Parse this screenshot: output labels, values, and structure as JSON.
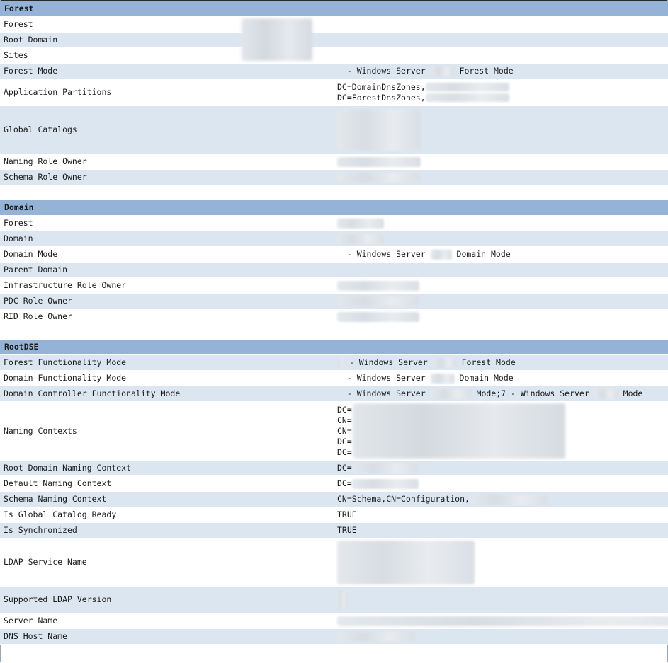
{
  "sections": {
    "forest": {
      "title": "Forest",
      "rows": [
        {
          "label": "Forest",
          "value": ""
        },
        {
          "label": "Root Domain",
          "value": ""
        },
        {
          "label": "Sites",
          "value": ""
        },
        {
          "label": "Forest Mode",
          "value_pre": "- Windows Server",
          "value_post": "Forest Mode"
        },
        {
          "label": "Application Partitions",
          "lines": [
            "DC=DomainDnsZones,",
            "DC=ForestDnsZones,"
          ]
        },
        {
          "label": "Global Catalogs",
          "value": ""
        },
        {
          "label": "Naming Role Owner",
          "value": ""
        },
        {
          "label": "Schema Role Owner",
          "value": ""
        }
      ]
    },
    "domain": {
      "title": "Domain",
      "rows": [
        {
          "label": "Forest",
          "value": ""
        },
        {
          "label": "Domain",
          "value": ""
        },
        {
          "label": "Domain Mode",
          "value_pre": "- Windows Server",
          "value_post": "Domain Mode"
        },
        {
          "label": "Parent Domain",
          "value": ""
        },
        {
          "label": "Infrastructure Role Owner",
          "value": ""
        },
        {
          "label": "PDC Role Owner",
          "value": ""
        },
        {
          "label": "RID Role Owner",
          "value": ""
        }
      ]
    },
    "rootdse": {
      "title": "RootDSE",
      "rows": [
        {
          "label": "Forest Functionality Mode",
          "value_pre": "- Windows Server",
          "value_post": "Forest Mode"
        },
        {
          "label": "Domain Functionality Mode",
          "value_pre": "- Windows Server",
          "value_post": "Domain Mode"
        },
        {
          "label": "Domain Controller Functionality Mode",
          "value_pre": "- Windows Server",
          "value_mid": "Mode;7 - Windows Server",
          "value_post": "Mode"
        },
        {
          "label": "Naming Contexts",
          "lines": [
            "DC=",
            "CN=",
            "CN=",
            "DC=",
            "DC="
          ]
        },
        {
          "label": "Root Domain Naming Context",
          "value": "DC="
        },
        {
          "label": "Default Naming Context",
          "value": "DC="
        },
        {
          "label": "Schema Naming Context",
          "value": "CN=Schema,CN=Configuration,"
        },
        {
          "label": "Is Global Catalog Ready",
          "value": "TRUE"
        },
        {
          "label": "Is Synchronized",
          "value": "TRUE"
        },
        {
          "label": "LDAP Service Name",
          "value": ""
        },
        {
          "label": "Supported LDAP Version",
          "value": ""
        },
        {
          "label": "Server Name",
          "value": ""
        },
        {
          "label": "DNS Host Name",
          "value": ""
        }
      ]
    }
  }
}
